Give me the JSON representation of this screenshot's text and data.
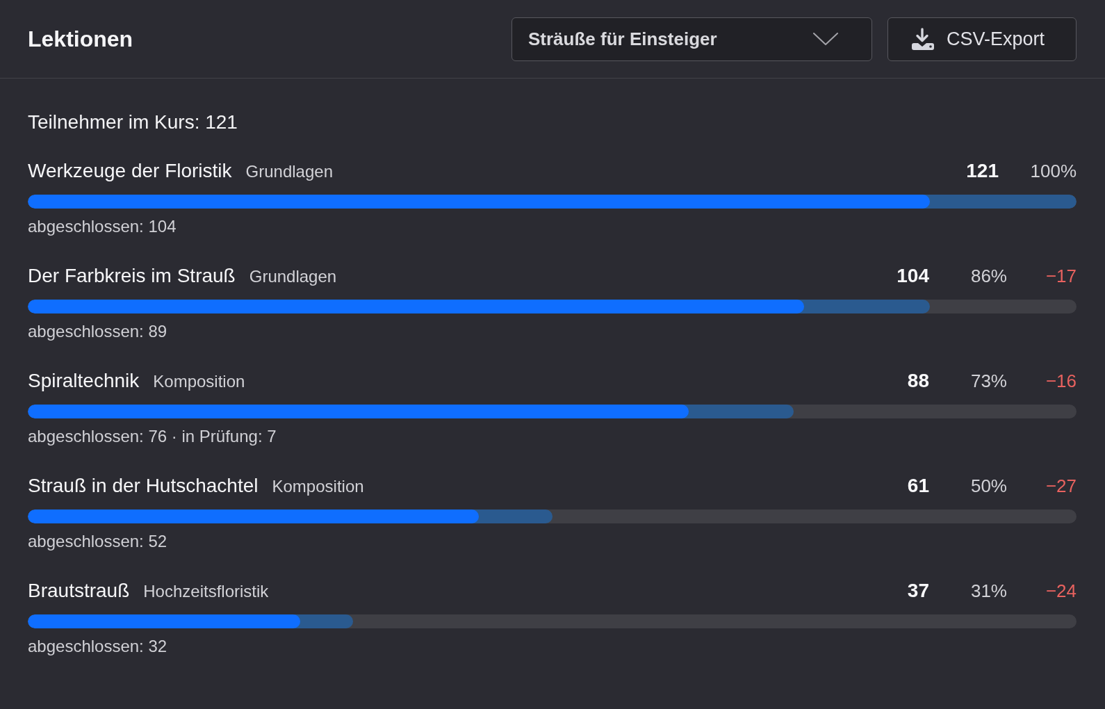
{
  "header": {
    "title": "Lektionen",
    "course_select": {
      "value": "Sträuße für Einsteiger"
    },
    "export_button": {
      "label": "CSV-Export"
    }
  },
  "summary": "Teilnehmer im Kurs: 121",
  "lessons": [
    {
      "title": "Werkzeuge der Floristik",
      "tag": "Grundlagen",
      "count": "121",
      "percent": "100%",
      "bar": {
        "reached": {
          "level": 1.0
        },
        "completed": {
          "level": 0.86
        }
      },
      "detail": "abgeschlossen: 104"
    },
    {
      "title": "Der Farbkreis im Strauß",
      "tag": "Grundlagen",
      "count": "104",
      "percent": "86%",
      "delta": "−17",
      "bar": {
        "reached": {
          "level": 0.86
        },
        "completed": {
          "level": 0.74
        }
      },
      "detail": "abgeschlossen: 89"
    },
    {
      "title": "Spiraltechnik",
      "tag": "Komposition",
      "count": "88",
      "percent": "73%",
      "delta": "−16",
      "bar": {
        "reached": {
          "level": 0.73
        },
        "completed": {
          "level": 0.63
        }
      },
      "detail": "abgeschlossen: 76 · in Prüfung: 7"
    },
    {
      "title": "Strauß in der Hutschachtel",
      "tag": "Komposition",
      "count": "61",
      "percent": "50%",
      "delta": "−27",
      "bar": {
        "reached": {
          "level": 0.5
        },
        "completed": {
          "level": 0.43
        }
      },
      "detail": "abgeschlossen: 52"
    },
    {
      "title": "Brautstrauß",
      "tag": "Hochzeitsfloristik",
      "count": "37",
      "percent": "31%",
      "delta": "−24",
      "bar": {
        "reached": {
          "level": 0.31
        },
        "completed": {
          "level": 0.26
        }
      },
      "detail": "abgeschlossen: 32"
    }
  ]
}
